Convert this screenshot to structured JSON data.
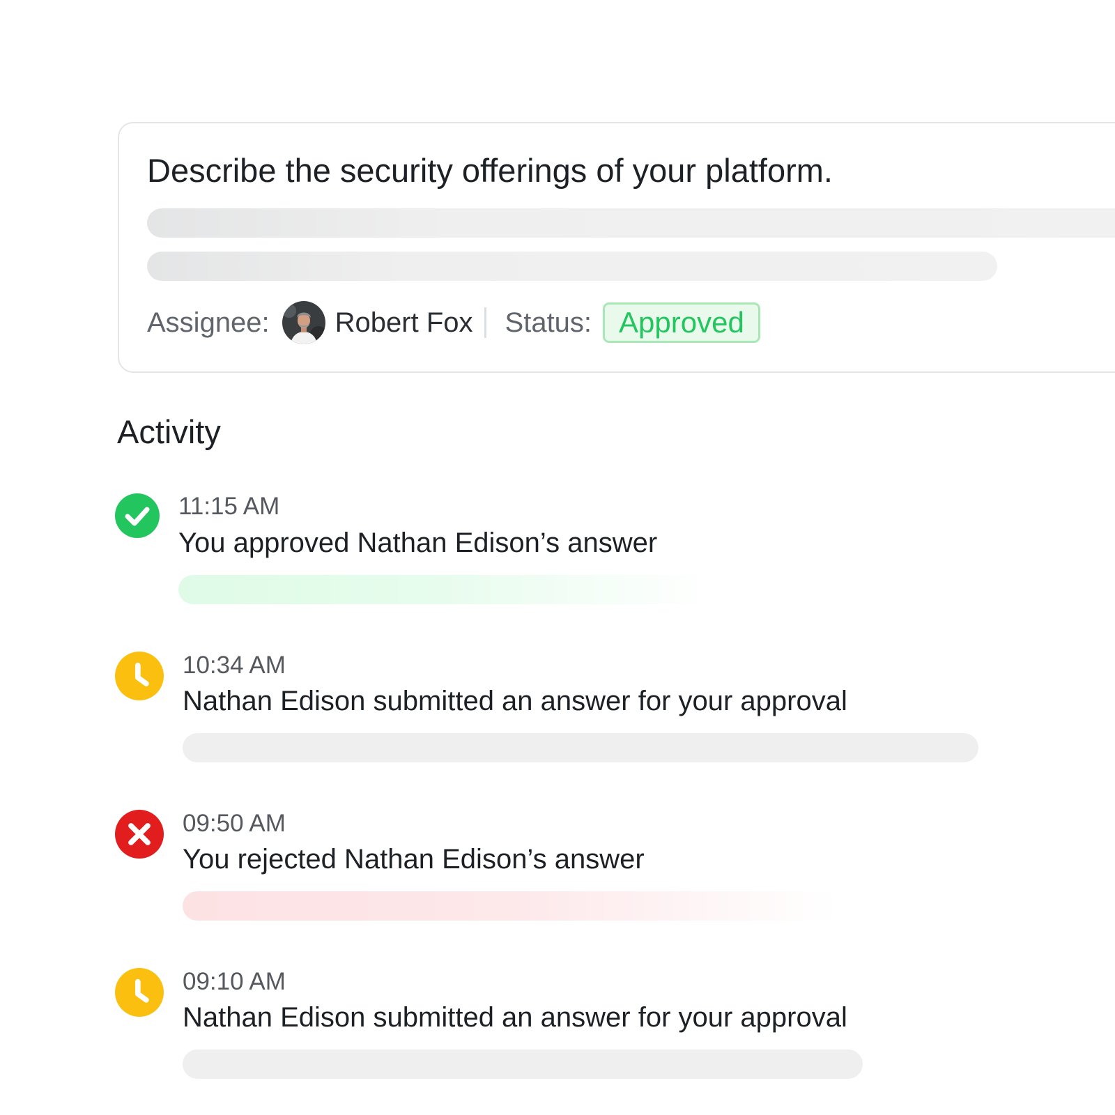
{
  "question": {
    "title": "Describe the security offerings of your platform.",
    "assignee_label": "Assignee:",
    "assignee_name": "Robert Fox",
    "status_label": "Status:",
    "status_value": "Approved"
  },
  "activity": {
    "heading": "Activity",
    "items": [
      {
        "time": "11:15 AM",
        "text": "You approved Nathan Edison’s answer",
        "icon": "check-icon",
        "status": "approved",
        "color": "#22c55e"
      },
      {
        "time": "10:34 AM",
        "text": "Nathan Edison submitted an answer for your approval",
        "icon": "clock-icon",
        "status": "pending",
        "color": "#fbbf0f"
      },
      {
        "time": "09:50 AM",
        "text": "You rejected Nathan Edison’s answer",
        "icon": "x-icon",
        "status": "rejected",
        "color": "#e11d1d"
      },
      {
        "time": "09:10 AM",
        "text": "Nathan Edison submitted an answer for your approval",
        "icon": "clock-icon",
        "status": "pending",
        "color": "#fbbf0f"
      }
    ]
  },
  "colors": {
    "approved_green": "#22c55e",
    "pending_amber": "#fbbf0f",
    "rejected_red": "#e11d1d",
    "badge_background": "#e9f9ec",
    "badge_border": "#a9e7b6"
  }
}
